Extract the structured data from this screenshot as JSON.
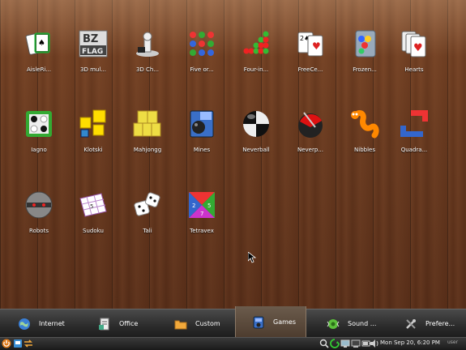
{
  "apps": [
    {
      "label": "AisleRi...",
      "icon": "aisleriot-cards-icon"
    },
    {
      "label": "3D mul...",
      "icon": "bzflag-icon"
    },
    {
      "label": "3D Ch...",
      "icon": "chess-piece-icon"
    },
    {
      "label": "Five or...",
      "icon": "five-or-more-icon"
    },
    {
      "label": "Four-in...",
      "icon": "four-in-a-row-icon"
    },
    {
      "label": "FreeCe...",
      "icon": "freecell-cards-icon"
    },
    {
      "label": "Frozen...",
      "icon": "frozen-bubble-icon"
    },
    {
      "label": "Hearts",
      "icon": "hearts-cards-icon"
    },
    {
      "label": "Iagno",
      "icon": "iagno-icon"
    },
    {
      "label": "Klotski",
      "icon": "klotski-icon"
    },
    {
      "label": "Mahjongg",
      "icon": "mahjongg-icon"
    },
    {
      "label": "Mines",
      "icon": "mines-icon"
    },
    {
      "label": "Neverball",
      "icon": "neverball-icon"
    },
    {
      "label": "Neverp...",
      "icon": "neverputt-icon"
    },
    {
      "label": "Nibbles",
      "icon": "nibbles-worm-icon"
    },
    {
      "label": "Quadra...",
      "icon": "quadrapassel-icon"
    },
    {
      "label": "Robots",
      "icon": "robots-icon"
    },
    {
      "label": "Sudoku",
      "icon": "sudoku-icon"
    },
    {
      "label": "Tali",
      "icon": "tali-dice-icon"
    },
    {
      "label": "Tetravex",
      "icon": "tetravex-icon"
    }
  ],
  "tabs": [
    {
      "label": "Internet",
      "icon": "globe-icon",
      "active": false
    },
    {
      "label": "Office",
      "icon": "office-document-icon",
      "active": false
    },
    {
      "label": "Custom",
      "icon": "folder-icon",
      "active": false
    },
    {
      "label": "Games",
      "icon": "games-icon",
      "active": true
    },
    {
      "label": "Sound ...",
      "icon": "sound-icon",
      "active": false
    },
    {
      "label": "Prefere...",
      "icon": "preferences-tools-icon",
      "active": false
    }
  ],
  "panel": {
    "clock": "Mon Sep 20,  6:20 PM",
    "user": "user"
  }
}
